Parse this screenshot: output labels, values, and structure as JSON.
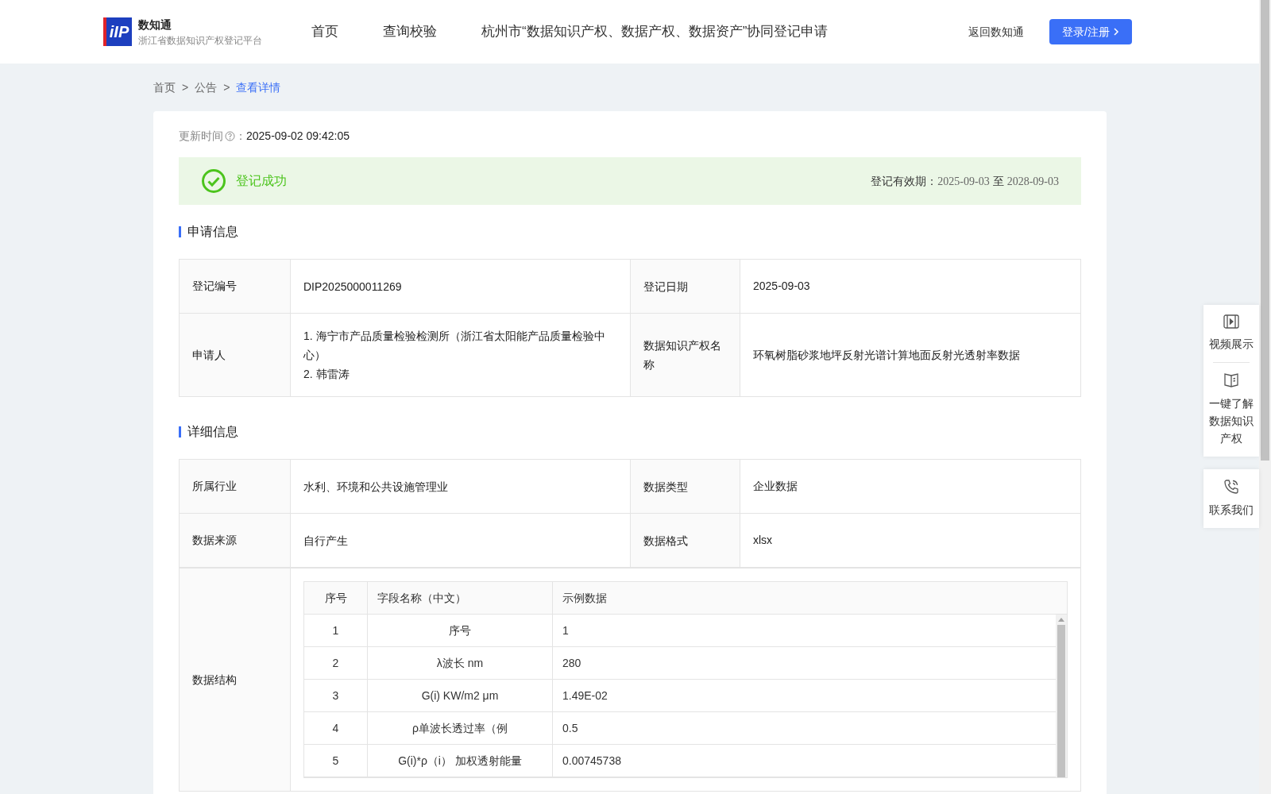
{
  "header": {
    "logo_text": "iIP",
    "site_name": "数知通",
    "site_subtitle": "浙江省数据知识产权登记平台",
    "nav": [
      {
        "label": "首页",
        "selected": false
      },
      {
        "label": "查询校验",
        "selected": false
      },
      {
        "label": "杭州市“数据知识产权、数据产权、数据资产”协同登记申请",
        "selected": false
      }
    ],
    "back_link": "返回数知通",
    "login_button": "登录/注册"
  },
  "breadcrumb": [
    {
      "label": "首页",
      "selected": false
    },
    {
      "label": "公告",
      "selected": false
    },
    {
      "label": "查看详情",
      "selected": true
    }
  ],
  "breadcrumb_separator": ">",
  "update_time": {
    "label": "更新时间",
    "colon": "：",
    "value": "2025-09-02 09:42:05"
  },
  "status_banner": {
    "status": "登记成功",
    "validity_label": "登记有效期：",
    "validity_from": "2025-09-03",
    "validity_to_word": "至",
    "validity_to": "2028-09-03"
  },
  "application_section": {
    "title": "申请信息",
    "rows": [
      {
        "label1": "登记编号",
        "value1": [
          "DIP2025000011269"
        ],
        "label2": "登记日期",
        "value2": "2025-09-03"
      },
      {
        "label1": "申请人",
        "value1": [
          "1. 海宁市产品质量检验检测所（浙江省太阳能产品质量检验中心）",
          "2. 韩雷涛"
        ],
        "label2": "数据知识产权名称",
        "value2": "环氧树脂砂浆地坪反射光谱计算地面反射光透射率数据"
      }
    ]
  },
  "detail_section": {
    "title": "详细信息",
    "rows": [
      {
        "label1": "所属行业",
        "value1": [
          "水利、环境和公共设施管理业"
        ],
        "label2": "数据类型",
        "value2": "企业数据"
      },
      {
        "label1": "数据来源",
        "value1": [
          "自行产生"
        ],
        "label2": "数据格式",
        "value2": "xlsx"
      }
    ],
    "structure_label": "数据结构",
    "structure_table": {
      "columns": [
        "序号",
        "字段名称（中文）",
        "示例数据"
      ],
      "rows": [
        [
          "1",
          "序号",
          "1"
        ],
        [
          "2",
          "λ波长 nm",
          "280"
        ],
        [
          "3",
          "G(i) KW/m2 μm",
          "1.49E-02"
        ],
        [
          "4",
          "ρ单波长透过率（例",
          "0.5"
        ],
        [
          "5",
          "G(i)*ρ（i） 加权透射能量",
          "0.00745738"
        ]
      ]
    }
  },
  "side_panel": [
    {
      "kind": "video",
      "label": "视频展示"
    },
    {
      "kind": "book",
      "label": "一键了解数据知识产权"
    },
    {
      "kind": "phone",
      "label": "联系我们"
    }
  ]
}
